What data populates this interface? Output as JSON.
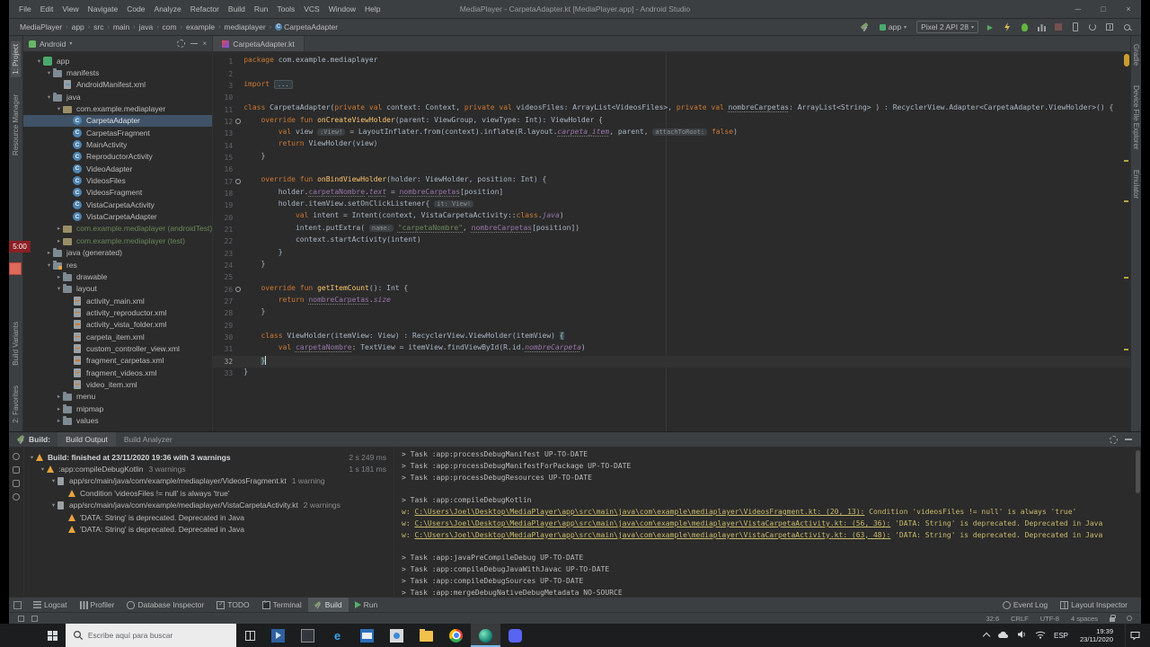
{
  "window": {
    "title": "MediaPlayer - CarpetaAdapter.kt [MediaPlayer.app] - Android Studio",
    "menus": [
      "File",
      "Edit",
      "View",
      "Navigate",
      "Code",
      "Analyze",
      "Refactor",
      "Build",
      "Run",
      "Tools",
      "VCS",
      "Window",
      "Help"
    ]
  },
  "toolbar": {
    "breadcrumbs": [
      "MediaPlayer",
      "app",
      "src",
      "main",
      "java",
      "com",
      "example",
      "mediaplayer",
      "CarpetaAdapter"
    ],
    "run_config": "app",
    "device": "Pixel 2 API 28"
  },
  "strips": {
    "left_top": [
      "1: Project",
      "Resource Manager"
    ],
    "left_bottom": [
      "Build Variants",
      "2: Favorites"
    ],
    "right": [
      "Gradle",
      "Device File Explorer",
      "Emulator"
    ]
  },
  "recorder": {
    "time": "5:00"
  },
  "project": {
    "header": "Android",
    "tree": [
      {
        "i": 1,
        "icon": "app",
        "arrow": "v",
        "label": "app"
      },
      {
        "i": 2,
        "icon": "folder",
        "arrow": "v",
        "label": "manifests"
      },
      {
        "i": 3,
        "icon": "file",
        "label": "AndroidManifest.xml"
      },
      {
        "i": 2,
        "icon": "folder",
        "arrow": "v",
        "label": "java"
      },
      {
        "i": 3,
        "icon": "pkg",
        "arrow": "v",
        "label": "com.example.mediaplayer"
      },
      {
        "i": 4,
        "icon": "kclass",
        "label": "CarpetaAdapter",
        "selected": true
      },
      {
        "i": 4,
        "icon": "kclass",
        "label": "CarpetasFragment"
      },
      {
        "i": 4,
        "icon": "kclass",
        "label": "MainActivity"
      },
      {
        "i": 4,
        "icon": "kclass",
        "label": "ReproductorActivity"
      },
      {
        "i": 4,
        "icon": "kclass",
        "label": "VideoAdapter"
      },
      {
        "i": 4,
        "icon": "kclass",
        "label": "VideosFiles"
      },
      {
        "i": 4,
        "icon": "kclass",
        "label": "VideosFragment"
      },
      {
        "i": 4,
        "icon": "kclass",
        "label": "VistaCarpetaActivity"
      },
      {
        "i": 4,
        "icon": "kclass",
        "label": "VistaCarpetaAdapter"
      },
      {
        "i": 3,
        "icon": "pkg",
        "arrow": ">",
        "label": "com.example.mediaplayer (androidTest)",
        "cls": "test"
      },
      {
        "i": 3,
        "icon": "pkg",
        "arrow": ">",
        "label": "com.example.mediaplayer (test)",
        "cls": "test"
      },
      {
        "i": 2,
        "icon": "folder",
        "arrow": ">",
        "label": "java (generated)"
      },
      {
        "i": 2,
        "icon": "res",
        "arrow": "v",
        "label": "res"
      },
      {
        "i": 3,
        "icon": "folder",
        "arrow": ">",
        "label": "drawable"
      },
      {
        "i": 3,
        "icon": "folder",
        "arrow": "v",
        "label": "layout"
      },
      {
        "i": 4,
        "icon": "xml",
        "label": "activity_main.xml"
      },
      {
        "i": 4,
        "icon": "xml",
        "label": "activity_reproductor.xml"
      },
      {
        "i": 4,
        "icon": "xml",
        "label": "activity_vista_folder.xml"
      },
      {
        "i": 4,
        "icon": "xml",
        "label": "carpeta_item.xml"
      },
      {
        "i": 4,
        "icon": "xml",
        "label": "custom_controller_view.xml"
      },
      {
        "i": 4,
        "icon": "xml",
        "label": "fragment_carpetas.xml"
      },
      {
        "i": 4,
        "icon": "xml",
        "label": "fragment_videos.xml"
      },
      {
        "i": 4,
        "icon": "xml",
        "label": "video_item.xml"
      },
      {
        "i": 3,
        "icon": "folder",
        "arrow": ">",
        "label": "menu"
      },
      {
        "i": 3,
        "icon": "folder",
        "arrow": ">",
        "label": "mipmap"
      },
      {
        "i": 3,
        "icon": "folder",
        "arrow": ">",
        "label": "values"
      }
    ]
  },
  "editor": {
    "tab": "CarpetaAdapter.kt",
    "lines": [
      {
        "n": "1",
        "tk": [
          [
            "k",
            "package"
          ],
          [
            "t",
            " com.example.mediaplayer"
          ]
        ]
      },
      {
        "n": "2",
        "tk": []
      },
      {
        "n": "3",
        "tk": [
          [
            "k",
            "import "
          ],
          [
            "fold",
            "..."
          ]
        ]
      },
      {
        "n": "10",
        "tk": []
      },
      {
        "n": "11",
        "tk": [
          [
            "k",
            "class "
          ],
          [
            "t",
            "CarpetaAdapter("
          ],
          [
            "k",
            "private val "
          ],
          [
            "t",
            "context: Context, "
          ],
          [
            "k",
            "private val "
          ],
          [
            "t",
            "videosFiles: ArrayList<VideosFiles>, "
          ],
          [
            "k",
            "private val "
          ],
          [
            "t u",
            "nombreCarpetas"
          ],
          [
            "t",
            ": ArrayList<String> ) : RecyclerView.Adapter<CarpetaAdapter.ViewHolder>() {"
          ]
        ]
      },
      {
        "n": "12",
        "ov": true,
        "tk": [
          [
            "t",
            "    "
          ],
          [
            "k",
            "override fun "
          ],
          [
            "f",
            "onCreateViewHolder"
          ],
          [
            "t",
            "(parent: ViewGroup, viewType: Int): ViewHolder {"
          ]
        ]
      },
      {
        "n": "13",
        "tk": [
          [
            "t",
            "        "
          ],
          [
            "k",
            "val "
          ],
          [
            "t",
            "view "
          ],
          [
            "h",
            ":View!"
          ],
          [
            "t",
            " = LayoutInflater.from(context).inflate(R.layout."
          ],
          [
            "p i u",
            "carpeta_item"
          ],
          [
            "t",
            ", parent, "
          ],
          [
            "h",
            "attachToRoot:"
          ],
          [
            "t",
            " "
          ],
          [
            "k",
            "false"
          ],
          [
            "t",
            ")"
          ]
        ]
      },
      {
        "n": "14",
        "tk": [
          [
            "t",
            "        "
          ],
          [
            "k",
            "return "
          ],
          [
            "t",
            "ViewHolder(view)"
          ]
        ]
      },
      {
        "n": "15",
        "tk": [
          [
            "t",
            "    }"
          ]
        ]
      },
      {
        "n": "16",
        "tk": []
      },
      {
        "n": "17",
        "ov": true,
        "tk": [
          [
            "t",
            "    "
          ],
          [
            "k",
            "override fun "
          ],
          [
            "f",
            "onBindViewHolder"
          ],
          [
            "t",
            "(holder: ViewHolder, position: Int) {"
          ]
        ]
      },
      {
        "n": "18",
        "tk": [
          [
            "t",
            "        holder."
          ],
          [
            "p u",
            "carpetaNombre"
          ],
          [
            "t",
            "."
          ],
          [
            "p i u",
            "text"
          ],
          [
            "t",
            " = "
          ],
          [
            "p u",
            "nombreCarpetas"
          ],
          [
            "t",
            "[position]"
          ]
        ]
      },
      {
        "n": "19",
        "tk": [
          [
            "t",
            "        holder.itemView.setOnClickListener{ "
          ],
          [
            "h",
            "it: View!"
          ]
        ]
      },
      {
        "n": "20",
        "tk": [
          [
            "t",
            "            "
          ],
          [
            "k",
            "val "
          ],
          [
            "t",
            "intent = Intent(context, VistaCarpetaActivity::"
          ],
          [
            "k",
            "class"
          ],
          [
            "t",
            "."
          ],
          [
            "p i",
            "java"
          ],
          [
            "t",
            ")"
          ]
        ]
      },
      {
        "n": "21",
        "tk": [
          [
            "t",
            "            intent.putExtra( "
          ],
          [
            "h",
            "name:"
          ],
          [
            "t",
            " "
          ],
          [
            "s u",
            "\"carpetaNombre\""
          ],
          [
            "t",
            ", "
          ],
          [
            "p u",
            "nombreCarpetas"
          ],
          [
            "t",
            "[position])"
          ]
        ]
      },
      {
        "n": "22",
        "tk": [
          [
            "t",
            "            context.startActivity(intent)"
          ]
        ]
      },
      {
        "n": "23",
        "tk": [
          [
            "t",
            "        }"
          ]
        ]
      },
      {
        "n": "24",
        "tk": [
          [
            "t",
            "    }"
          ]
        ]
      },
      {
        "n": "25",
        "tk": []
      },
      {
        "n": "26",
        "ov": true,
        "tk": [
          [
            "t",
            "    "
          ],
          [
            "k",
            "override fun "
          ],
          [
            "f",
            "getItemCount"
          ],
          [
            "t",
            "(): Int {"
          ]
        ]
      },
      {
        "n": "27",
        "tk": [
          [
            "t",
            "        "
          ],
          [
            "k",
            "return "
          ],
          [
            "p u",
            "nombreCarpetas"
          ],
          [
            "t",
            "."
          ],
          [
            "p i",
            "size"
          ]
        ]
      },
      {
        "n": "28",
        "tk": [
          [
            "t",
            "    }"
          ]
        ]
      },
      {
        "n": "29",
        "tk": []
      },
      {
        "n": "30",
        "tk": [
          [
            "t",
            "    "
          ],
          [
            "k",
            "class "
          ],
          [
            "t",
            "ViewHolder(itemView: View) : RecyclerView.ViewHolder(itemView) "
          ],
          [
            "bm",
            "{"
          ]
        ]
      },
      {
        "n": "31",
        "tk": [
          [
            "t",
            "        "
          ],
          [
            "k",
            "val "
          ],
          [
            "p u",
            "carpetaNombre"
          ],
          [
            "t",
            ": TextView = itemView.findViewById(R.id."
          ],
          [
            "p i u",
            "nombreCarpeta"
          ],
          [
            "t",
            ")"
          ]
        ]
      },
      {
        "n": "32",
        "cur": true,
        "caret": true,
        "tk": [
          [
            "t",
            "    "
          ],
          [
            "bm",
            "}"
          ]
        ]
      },
      {
        "n": "33",
        "tk": [
          [
            "t",
            "}"
          ]
        ]
      }
    ]
  },
  "build": {
    "label": "Build:",
    "tabs": [
      "Build Output",
      "Build Analyzer"
    ],
    "tree": [
      {
        "i": 0,
        "arrow": "v",
        "icon": "warn",
        "bold": true,
        "text": "Build: finished at 23/11/2020 19:36 with 3 warnings",
        "time": "2 s 249 ms"
      },
      {
        "i": 1,
        "arrow": "v",
        "icon": "warn",
        "text": ":app:compileDebugKotlin",
        "suffix": "3 warnings",
        "time": "1 s 181 ms"
      },
      {
        "i": 2,
        "arrow": "v",
        "icon": "file",
        "text": "app/src/main/java/com/example/mediaplayer/VideosFragment.kt",
        "suffix": "1 warning"
      },
      {
        "i": 3,
        "icon": "warn",
        "text": "Condition 'videosFiles != null' is always 'true'"
      },
      {
        "i": 2,
        "arrow": "v",
        "icon": "file",
        "text": "app/src/main/java/com/example/mediaplayer/VistaCarpetaActivity.kt",
        "suffix": "2 warnings"
      },
      {
        "i": 3,
        "icon": "warn",
        "text": "'DATA: String' is deprecated. Deprecated in Java"
      },
      {
        "i": 3,
        "icon": "warn",
        "text": "'DATA: String' is deprecated. Deprecated in Java"
      }
    ],
    "console": [
      {
        "t": "task",
        "text": "> Task :app:processDebugManifest UP-TO-DATE"
      },
      {
        "t": "task",
        "text": "> Task :app:processDebugManifestForPackage UP-TO-DATE"
      },
      {
        "t": "task",
        "text": "> Task :app:processDebugResources UP-TO-DATE"
      },
      {
        "t": "blank"
      },
      {
        "t": "task",
        "text": "> Task :app:compileDebugKotlin"
      },
      {
        "t": "warn",
        "pre": "w: ",
        "link": "C:\\Users\\Joel\\Desktop\\MediaPlayer\\app\\src\\main\\java\\com\\example\\mediaplayer\\VideosFragment.kt: (20, 13):",
        "msg": " Condition 'videosFiles != null' is always 'true'"
      },
      {
        "t": "warn",
        "pre": "w: ",
        "link": "C:\\Users\\Joel\\Desktop\\MediaPlayer\\app\\src\\main\\java\\com\\example\\mediaplayer\\VistaCarpetaActivity.kt: (56, 36):",
        "msg": " 'DATA: String' is deprecated. Deprecated in Java"
      },
      {
        "t": "warn",
        "pre": "w: ",
        "link": "C:\\Users\\Joel\\Desktop\\MediaPlayer\\app\\src\\main\\java\\com\\example\\mediaplayer\\VistaCarpetaActivity.kt: (63, 48):",
        "msg": " 'DATA: String' is deprecated. Deprecated in Java"
      },
      {
        "t": "blank"
      },
      {
        "t": "task",
        "text": "> Task :app:javaPreCompileDebug UP-TO-DATE"
      },
      {
        "t": "task",
        "text": "> Task :app:compileDebugJavaWithJavac UP-TO-DATE"
      },
      {
        "t": "task",
        "text": "> Task :app:compileDebugSources UP-TO-DATE"
      },
      {
        "t": "task",
        "text": "> Task :app:mergeDebugNativeDebugMetadata NO-SOURCE"
      }
    ]
  },
  "toolwindows": {
    "left": [
      {
        "label": "Logcat",
        "icon": "logcat"
      },
      {
        "label": "Profiler",
        "icon": "profiler"
      },
      {
        "label": "Database Inspector",
        "icon": "db"
      },
      {
        "label": "TODO",
        "icon": "todo"
      },
      {
        "label": "Terminal",
        "icon": "terminal"
      },
      {
        "label": "Build",
        "icon": "build",
        "active": true
      },
      {
        "label": "Run",
        "icon": "run"
      }
    ],
    "right": [
      {
        "label": "Event Log",
        "icon": "eventlog"
      },
      {
        "label": "Layout Inspector",
        "icon": "layout"
      }
    ]
  },
  "statusbar": {
    "position": "32:6",
    "line_ending": "CRLF",
    "encoding": "UTF-8",
    "indent": "4 spaces"
  },
  "taskbar": {
    "search_placeholder": "Escribe aquí para buscar",
    "apps": [
      "movies",
      "calculator",
      "edge",
      "mail",
      "photos",
      "explorer",
      "chrome",
      "androidstudio",
      "discord"
    ],
    "active_app": "androidstudio",
    "tray_lang": "ESP",
    "time": "19:39",
    "date": "23/11/2020"
  }
}
